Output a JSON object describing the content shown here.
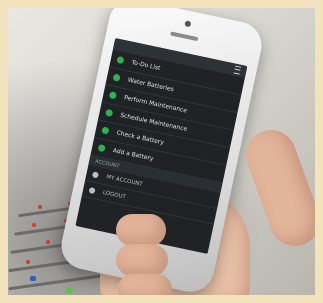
{
  "menu": {
    "items": [
      {
        "label": "To-Do List",
        "icon": "list-icon"
      },
      {
        "label": "Water Batteries",
        "icon": "droplet-icon"
      },
      {
        "label": "Perform Maintenance",
        "icon": "wrench-icon"
      },
      {
        "label": "Schedule Maintenance",
        "icon": "calendar-icon"
      },
      {
        "label": "Check a Battery",
        "icon": "check-icon"
      },
      {
        "label": "Add a Battery",
        "icon": "plus-icon"
      }
    ],
    "section_label": "ACCOUNT",
    "account_items": [
      {
        "label": "MY ACCOUNT",
        "icon": "user-icon"
      },
      {
        "label": "LOGOUT",
        "icon": "logout-icon"
      }
    ]
  },
  "colors": {
    "page_border": "#f3e3bd",
    "menu_bg": "#1f2326",
    "accent_green": "#2fb150",
    "menu_text": "#e2e2e2"
  }
}
